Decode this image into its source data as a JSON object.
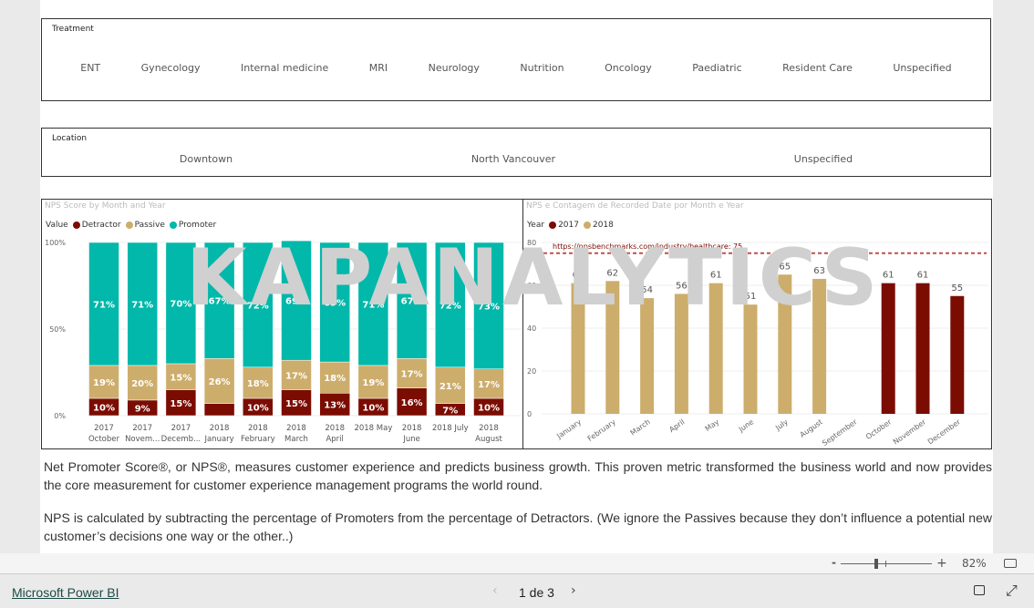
{
  "treatment": {
    "label": "Treatment",
    "items": [
      "ENT",
      "Gynecology",
      "Internal medicine",
      "MRI",
      "Neurology",
      "Nutrition",
      "Oncology",
      "Paediatric",
      "Resident Care",
      "Unspecified"
    ]
  },
  "location": {
    "label": "Location",
    "items": [
      "Downtown",
      "North Vancouver",
      "Unspecified"
    ]
  },
  "watermark": "KAPANALYTICS",
  "chart_data": [
    {
      "type": "bar",
      "stacked": "100%",
      "title": "NPS Score by Month and Year",
      "legend_title": "Value",
      "legend_position": "top-left",
      "categories": [
        [
          "2017",
          "October"
        ],
        [
          "2017",
          "Novem..."
        ],
        [
          "2017",
          "Decemb..."
        ],
        [
          "2018",
          "January"
        ],
        [
          "2018",
          "February"
        ],
        [
          "2018",
          "March"
        ],
        [
          "2018",
          "April"
        ],
        [
          "2018 May",
          ""
        ],
        [
          "2018",
          "June"
        ],
        [
          "2018 July",
          ""
        ],
        [
          "2018",
          "August"
        ]
      ],
      "yticks": [
        "100%",
        "50%",
        "0%"
      ],
      "ylim": [
        0,
        100
      ],
      "series": [
        {
          "name": "Detractor",
          "color": "#7b0c02",
          "values": [
            10,
            9,
            15,
            7,
            10,
            15,
            13,
            10,
            16,
            7,
            10
          ],
          "labels": [
            "10%",
            "9%",
            "15%",
            "",
            "10%",
            "15%",
            "13%",
            "10%",
            "16%",
            "7%",
            "10%"
          ]
        },
        {
          "name": "Passive",
          "color": "#cdad6c",
          "values": [
            19,
            20,
            15,
            26,
            18,
            17,
            18,
            19,
            17,
            21,
            17
          ],
          "labels": [
            "19%",
            "20%",
            "15%",
            "26%",
            "18%",
            "17%",
            "18%",
            "19%",
            "17%",
            "21%",
            "17%"
          ]
        },
        {
          "name": "Promoter",
          "color": "#01b8aa",
          "values": [
            71,
            71,
            70,
            67,
            72,
            69,
            69,
            71,
            67,
            72,
            73
          ],
          "labels": [
            "71%",
            "71%",
            "70%",
            "67%",
            "72%",
            "69%",
            "69%",
            "71%",
            "67%",
            "72%",
            "73%"
          ]
        }
      ]
    },
    {
      "type": "bar",
      "title": "NPS e Contagem de Recorded Date por Month e Year",
      "legend_title": "Year",
      "legend_position": "top-left",
      "categories": [
        "January",
        "February",
        "March",
        "April",
        "May",
        "June",
        "July",
        "August",
        "September",
        "October",
        "November",
        "December"
      ],
      "ylim": [
        0,
        80
      ],
      "yticks": [
        80,
        60,
        40,
        20,
        0
      ],
      "grid": true,
      "series": [
        {
          "name": "2017",
          "color": "#7b0c02",
          "values": [
            null,
            null,
            null,
            null,
            null,
            null,
            null,
            null,
            null,
            61,
            61,
            55
          ]
        },
        {
          "name": "2018",
          "color": "#cdad6c",
          "values": [
            61,
            62,
            54,
            56,
            61,
            51,
            65,
            63,
            null,
            null,
            null,
            null
          ]
        }
      ],
      "reference_line": {
        "value": 75,
        "label": "https://npsbenchmarks.com/industry/healthcare: 75",
        "color": "#c0504d"
      }
    }
  ],
  "description": [
    "Net Promoter Score®, or NPS®, measures customer experience and predicts business growth. This proven metric transformed the business world and now provides the core measurement for customer experience management programs the world round.",
    "NPS is calculated by subtracting the percentage of Promoters from the percentage of Detractors. (We ignore the Passives because they don’t influence a potential new customer’s decisions one way or the other..)"
  ],
  "zoom": {
    "minus": "-",
    "plus": "+",
    "level": "82%",
    "value": 82
  },
  "footer": {
    "brand": "Microsoft Power BI",
    "page": "1 de 3"
  }
}
